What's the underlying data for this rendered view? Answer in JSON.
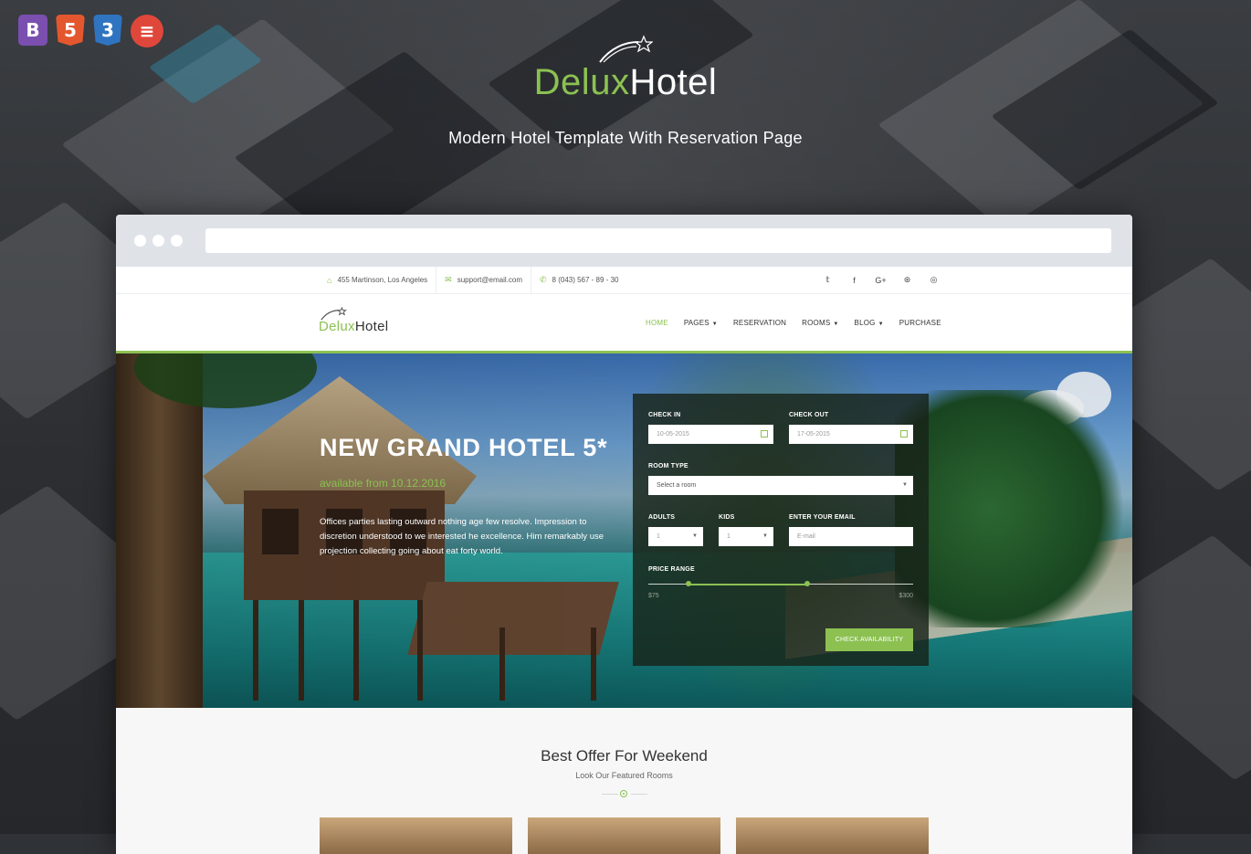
{
  "brand": {
    "name_part1": "Delux",
    "name_part2": "Hotel",
    "tagline": "Modern Hotel Template With Reservation Page",
    "accent_color": "#8cc152"
  },
  "badges": [
    {
      "icon": "bootstrap-icon",
      "glyph": "B"
    },
    {
      "icon": "html5-icon",
      "glyph": "5"
    },
    {
      "icon": "css3-icon",
      "glyph": "3"
    },
    {
      "icon": "award-icon",
      "glyph": "≡"
    }
  ],
  "topbar": {
    "address": "455 Martinson, Los Angeles",
    "email": "support@email.com",
    "phone": "8 (043) 567 - 89 - 30",
    "social": [
      "twitter-icon",
      "facebook-icon",
      "google-plus-icon",
      "dribbble-icon",
      "instagram-icon"
    ],
    "social_glyphs": [
      "𝕥",
      "f",
      "G+",
      "⊛",
      "◎"
    ]
  },
  "nav": {
    "items": [
      {
        "label": "HOME",
        "dropdown": false
      },
      {
        "label": "PAGES",
        "dropdown": true
      },
      {
        "label": "RESERVATION",
        "dropdown": false
      },
      {
        "label": "ROOMS",
        "dropdown": true
      },
      {
        "label": "BLOG",
        "dropdown": true
      },
      {
        "label": "PURCHASE",
        "dropdown": false
      }
    ]
  },
  "hero": {
    "title": "NEW GRAND HOTEL 5*",
    "subtitle": "available from 10.12.2016",
    "description": "Offices parties lasting outward nothing age few resolve. Impression to discretion understood to we interested he excellence. Him remarkably use projection collecting going about eat forty world."
  },
  "booking": {
    "check_in_label": "CHECK IN",
    "check_in_value": "10-05-2015",
    "check_out_label": "CHECK OUT",
    "check_out_value": "17-05-2015",
    "room_type_label": "ROOM TYPE",
    "room_type_value": "Select a room",
    "adults_label": "ADULTS",
    "adults_value": "1",
    "kids_label": "KIDS",
    "kids_value": "1",
    "email_label": "ENTER YOUR EMAIL",
    "email_placeholder": "E-mail",
    "price_label": "PRICE RANGE",
    "price_min_label": "$75",
    "price_max_label": "$300",
    "price_low_fraction": 0.15,
    "price_high_fraction": 0.6,
    "submit_label": "CHECK AVAILABILITY"
  },
  "offers": {
    "title": "Best Offer For Weekend",
    "subtitle": "Look Our Featured Rooms"
  }
}
